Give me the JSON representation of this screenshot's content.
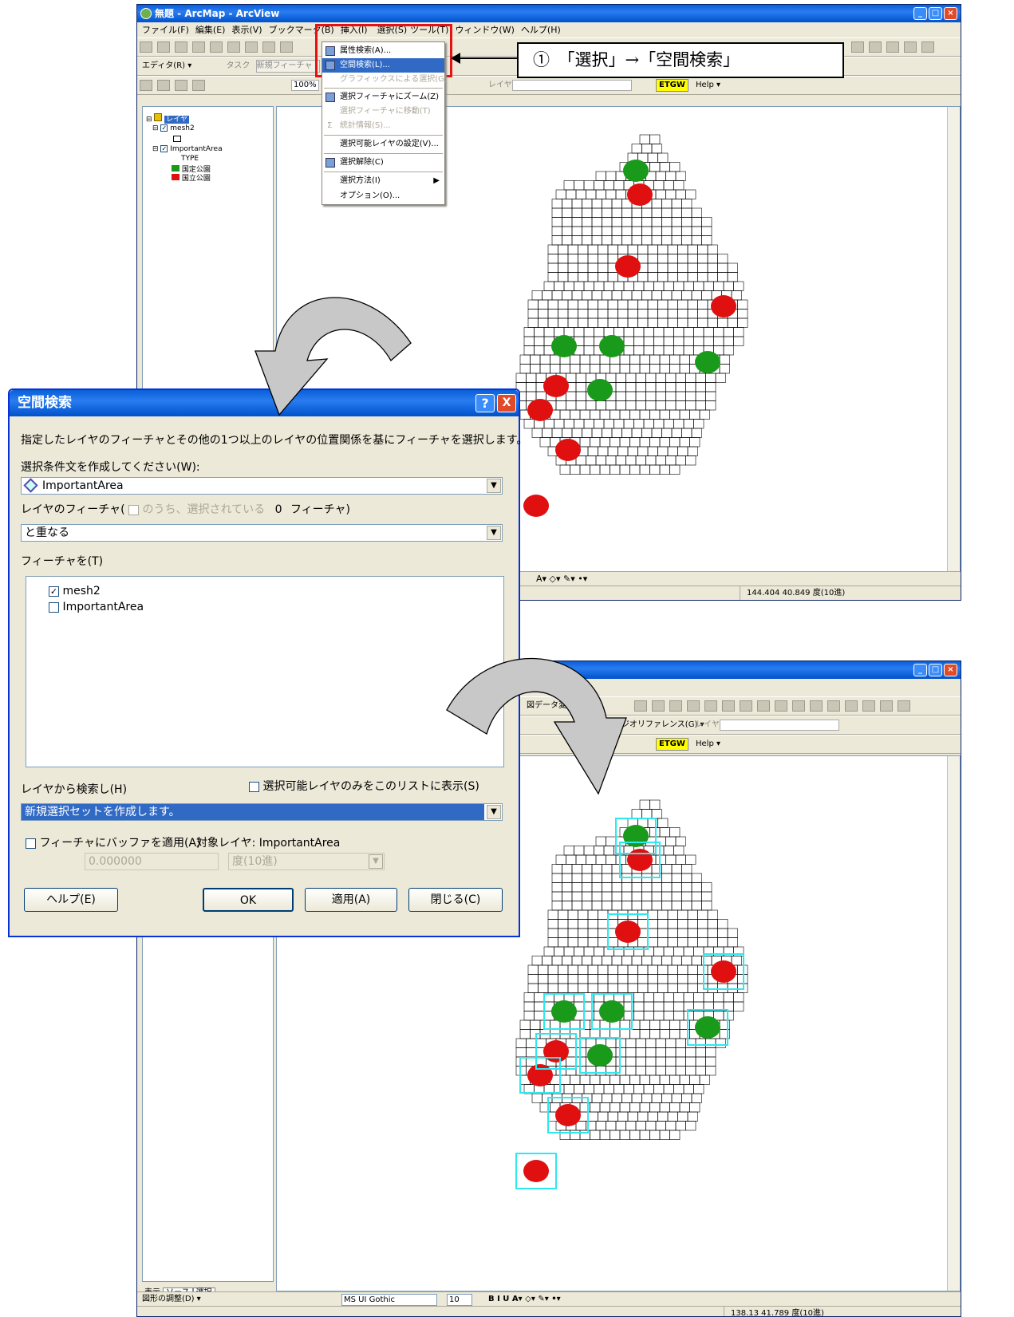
{
  "window1": {
    "title": "無題 - ArcMap - ArcView",
    "menus": [
      "ファイル(F)",
      "編集(E)",
      "表示(V)",
      "ブックマーク(B)",
      "挿入(I)",
      "選択(S)",
      "ツール(T)",
      "ウィンドウ(W)",
      "ヘルプ(H)"
    ],
    "editor_label": "エディタ(R) ▾",
    "task_label": "タスク",
    "task_value": "新規フィーチャ",
    "layer_label": "レイヤ:",
    "etgw": "ETGW",
    "help": "Help ▾",
    "zoom": "100%",
    "status_coords": "144.404  40.849 度(10進)"
  },
  "toc": {
    "root": "レイヤ",
    "layer1": "mesh2",
    "layer2": "ImportantArea",
    "field": "TYPE",
    "legend": [
      {
        "label": "国定公園",
        "color": "#1a9a1a"
      },
      {
        "label": "国立公園",
        "color": "#e01010"
      }
    ]
  },
  "select_menu": {
    "items": [
      {
        "label": "属性検索(A)...",
        "state": "normal"
      },
      {
        "label": "空間検索(L)...",
        "state": "selected"
      },
      {
        "label": "グラフィックスによる選択(G)",
        "state": "disabled"
      },
      {
        "label": "選択フィーチャにズーム(Z)",
        "state": "normal"
      },
      {
        "label": "選択フィーチャに移動(T)",
        "state": "disabled"
      },
      {
        "label": "統計情報(S)...",
        "state": "disabled"
      },
      {
        "label": "選択可能レイヤの設定(V)...",
        "state": "normal"
      },
      {
        "label": "選択解除(C)",
        "state": "normal"
      },
      {
        "label": "選択方法(I)",
        "state": "normal"
      },
      {
        "label": "オプション(O)...",
        "state": "normal"
      }
    ]
  },
  "callout": {
    "text": "①　「選択」→「空間検索」"
  },
  "dialog": {
    "title": "空間検索",
    "help_btn": "?",
    "close_btn": "X",
    "description": "指定したレイヤのフィーチャとその他の1つ以上のレイヤの位置関係を基にフィーチャを選択します。",
    "condition_label": "選択条件文を作成してください(W):",
    "source_layer": "ImportantArea",
    "features_prefix": "レイヤのフィーチャ(",
    "selected_only": "のうち、選択されている",
    "selected_count": "0",
    "features_suffix": "フィーチャ)",
    "relation": "と重なる",
    "target_label": "フィーチャを(T)",
    "targets": [
      {
        "label": "mesh2",
        "checked": true
      },
      {
        "label": "ImportantArea",
        "checked": false
      }
    ],
    "search_from": "レイヤから検索し(H)",
    "selectable_only": "選択可能レイヤのみをこのリストに表示(S)",
    "method": "新規選択セットを作成します。",
    "buffer_label": "フィーチャにバッファを適用(A)",
    "target_layer_label": "対象レイヤ: ImportantArea",
    "buffer_value": "0.000000",
    "buffer_unit": "度(10進)",
    "buttons": {
      "help": "ヘルプ(E)",
      "ok": "OK",
      "apply": "適用(A)",
      "close": "閉じる(C)"
    }
  },
  "window2": {
    "toolbar_text": "図データ変換ツー",
    "georef": "ジオリファレンス(G) ▾",
    "layer_label": "レイヤ:",
    "etgw": "ETGW",
    "help": "Help ▾",
    "tabs": [
      "表示",
      "ソース",
      "選択"
    ],
    "draw_label": "図形の調整(D) ▾",
    "font": "MS UI Gothic",
    "font_size": "10",
    "status_coords": "138.13  41.789 度(10進)"
  }
}
